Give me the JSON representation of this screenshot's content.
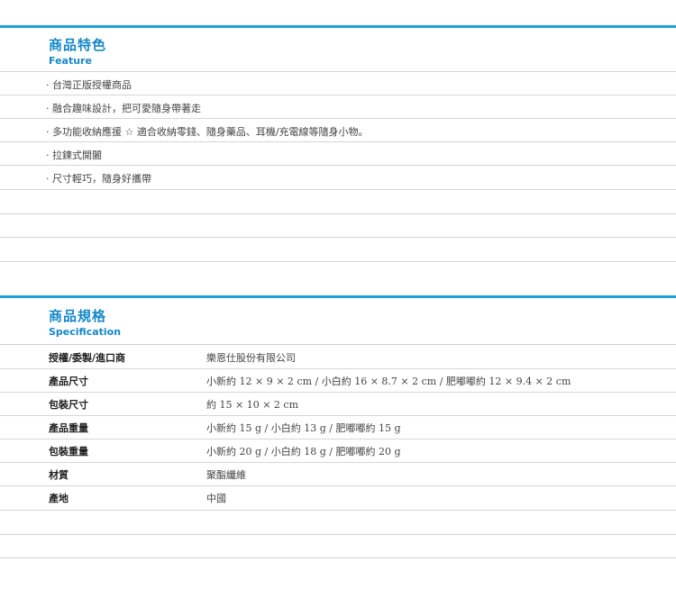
{
  "feature": {
    "title_zh": "商品特色",
    "title_en": "Feature",
    "items": [
      "‧ 台灣正版授權商品",
      "‧ 融合趣味設計，把可愛隨身帶著走",
      "‧ 多功能收納應援 ☆ 適合收納零錢、隨身藥品、耳機/充電線等隨身小物。",
      "‧ 拉鍊式開闔",
      "‧ 尺寸輕巧，隨身好攜帶"
    ]
  },
  "spec": {
    "title_zh": "商品規格",
    "title_en": "Specification",
    "rows": [
      {
        "label": "授權/委製/進口商",
        "value": "樂恩仕股份有限公司"
      },
      {
        "label": "產品尺寸",
        "value": "小新約 12 × 9 × 2 cm / 小白約 16 × 8.7 × 2 cm / 肥嘟嘟約 12 × 9.4 × 2 cm"
      },
      {
        "label": "包裝尺寸",
        "value": "約 15 × 10 × 2 cm"
      },
      {
        "label": "產品重量",
        "value": "小新約 15 g / 小白約 13 g / 肥嘟嘟約 15 g"
      },
      {
        "label": "包裝重量",
        "value": "小新約 20 g / 小白約 18 g / 肥嘟嘟約 20 g"
      },
      {
        "label": "材質",
        "value": "聚酯纖維"
      },
      {
        "label": "產地",
        "value": "中國"
      }
    ]
  },
  "colors": {
    "accent": "#1fa0d8",
    "heading": "#1588c8",
    "rule": "#d6d6d6"
  }
}
